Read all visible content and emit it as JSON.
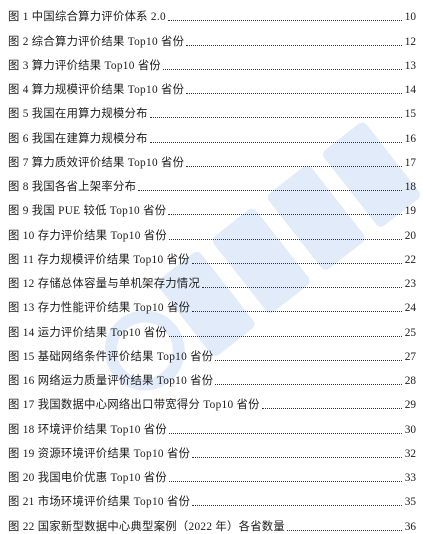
{
  "toc": {
    "entries": [
      {
        "label": "图 1 中国综合算力评价体系 2.0",
        "page": "10"
      },
      {
        "label": "图 2 综合算力评价结果 Top10 省份",
        "page": "12"
      },
      {
        "label": "图 3 算力评价结果 Top10 省份",
        "page": "13"
      },
      {
        "label": "图 4 算力规模评价结果 Top10 省份",
        "page": "14"
      },
      {
        "label": "图 5 我国在用算力规模分布",
        "page": "15"
      },
      {
        "label": "图 6 我国在建算力规模分布",
        "page": "16"
      },
      {
        "label": "图 7 算力质效评价结果 Top10 省份",
        "page": "17"
      },
      {
        "label": "图 8 我国各省上架率分布",
        "page": "18"
      },
      {
        "label": "图 9 我国 PUE 较低 Top10 省份",
        "page": "19"
      },
      {
        "label": "图 10 存力评价结果 Top10 省份",
        "page": "20"
      },
      {
        "label": "图 11 存力规模评价结果 Top10 省份",
        "page": "22"
      },
      {
        "label": "图 12 存储总体容量与单机架存力情况",
        "page": "23"
      },
      {
        "label": "图 13 存力性能评价结果 Top10 省份",
        "page": "24"
      },
      {
        "label": "图 14 运力评价结果 Top10 省份",
        "page": "25"
      },
      {
        "label": "图 15 基础网络条件评价结果 Top10 省份",
        "page": "27"
      },
      {
        "label": "图 16 网络运力质量评价结果 Top10 省份",
        "page": "28"
      },
      {
        "label": "图 17 我国数据中心网络出口带宽得分 Top10 省份",
        "page": "29"
      },
      {
        "label": "图 18 环境评价结果 Top10 省份",
        "page": "30"
      },
      {
        "label": "图 19 资源环境评价结果 Top10 省份",
        "page": "32"
      },
      {
        "label": "图 20 我国电价优惠 Top10 省份",
        "page": "33"
      },
      {
        "label": "图 21 市场环境评价结果 Top10 省份",
        "page": "35"
      },
      {
        "label": "图 22 国家新型数据中心典型案例（2022 年）各省数量",
        "page": "36"
      }
    ]
  }
}
